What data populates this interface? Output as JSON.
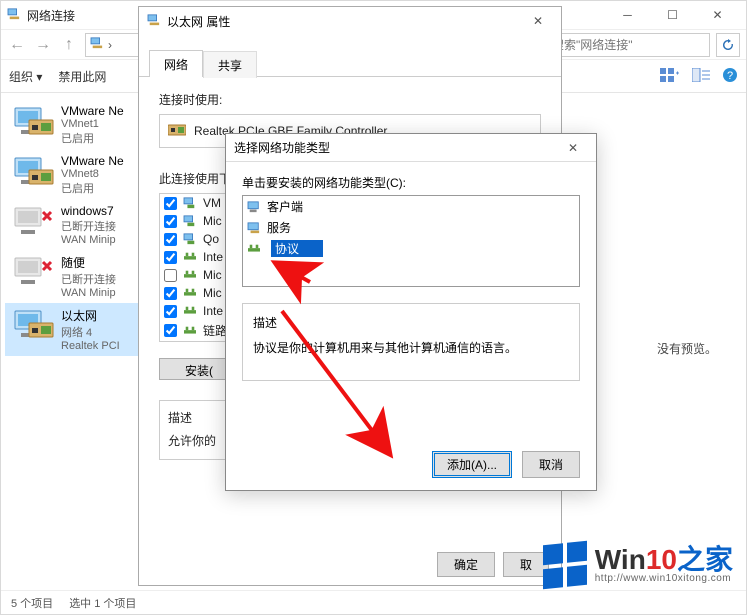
{
  "explorer": {
    "title": "网络连接",
    "search_placeholder": "搜索\"网络连接\"",
    "cmd_org": "组织 ▾",
    "cmd_disable": "禁用此网",
    "status_items": "5 个项目",
    "status_selected": "选中 1 个项目",
    "preview_note": "没有预览。",
    "items": [
      {
        "name": "VMware Ne",
        "sub1": "VMnet1",
        "sub2": "已启用"
      },
      {
        "name": "VMware Ne",
        "sub1": "VMnet8",
        "sub2": "已启用"
      },
      {
        "name": "windows7",
        "sub1": "已断开连接",
        "sub2": "WAN Minip"
      },
      {
        "name": "随便",
        "sub1": "已断开连接",
        "sub2": "WAN Minip"
      },
      {
        "name": "以太网",
        "sub1": "网络 4",
        "sub2": "Realtek PCI"
      }
    ]
  },
  "props": {
    "title": "以太网 属性",
    "tab_network": "网络",
    "tab_share": "共享",
    "connect_using": "连接时使用:",
    "adapter": "Realtek PCIe GBE Family Controller",
    "uses_items": "此连接使用下",
    "rows": [
      {
        "checked": true,
        "label": "VM"
      },
      {
        "checked": true,
        "label": "Mic"
      },
      {
        "checked": true,
        "label": "Qo"
      },
      {
        "checked": true,
        "label": "Inte"
      },
      {
        "checked": false,
        "label": "Mic"
      },
      {
        "checked": true,
        "label": "Mic"
      },
      {
        "checked": true,
        "label": "Inte"
      },
      {
        "checked": true,
        "label": "链路"
      }
    ],
    "install_btn": "安装(",
    "desc_header": "描述",
    "desc_text": "允许你的",
    "ok": "确定",
    "cancel": "取"
  },
  "ftype": {
    "title": "选择网络功能类型",
    "prompt": "单击要安装的网络功能类型(C):",
    "options": [
      {
        "label": "客户端",
        "selected": false
      },
      {
        "label": "服务",
        "selected": false
      },
      {
        "label": "协议",
        "selected": true
      }
    ],
    "desc_header": "描述",
    "desc_text": "协议是你的计算机用来与其他计算机通信的语言。",
    "add": "添加(A)...",
    "cancel": "取消"
  },
  "watermark": {
    "brand_a": "Win",
    "brand_b": "10",
    "brand_c": "之家",
    "url": "http://www.win10xitong.com"
  }
}
